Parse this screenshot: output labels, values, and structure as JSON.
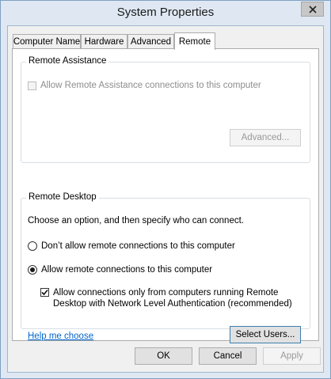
{
  "window": {
    "title": "System Properties"
  },
  "tabs": [
    {
      "label": "Computer Name",
      "active": false
    },
    {
      "label": "Hardware",
      "active": false
    },
    {
      "label": "Advanced",
      "active": false
    },
    {
      "label": "Remote",
      "active": true
    }
  ],
  "remote_assistance": {
    "group_label": "Remote Assistance",
    "allow_checkbox": {
      "label": "Allow Remote Assistance connections to this computer",
      "checked": false,
      "enabled": false
    },
    "advanced_button": "Advanced..."
  },
  "remote_desktop": {
    "group_label": "Remote Desktop",
    "instruction": "Choose an option, and then specify who can connect.",
    "option_dont_allow": {
      "label": "Don’t allow remote connections to this computer",
      "selected": false
    },
    "option_allow": {
      "label": "Allow remote connections to this computer",
      "selected": true
    },
    "nla_checkbox": {
      "line1": "Allow connections only from computers running Remote",
      "line2": "Desktop with Network Level Authentication (recommended)",
      "checked": true
    },
    "help_link": "Help me choose",
    "select_users_button": "Select Users..."
  },
  "footer": {
    "ok": "OK",
    "cancel": "Cancel",
    "apply": "Apply"
  }
}
